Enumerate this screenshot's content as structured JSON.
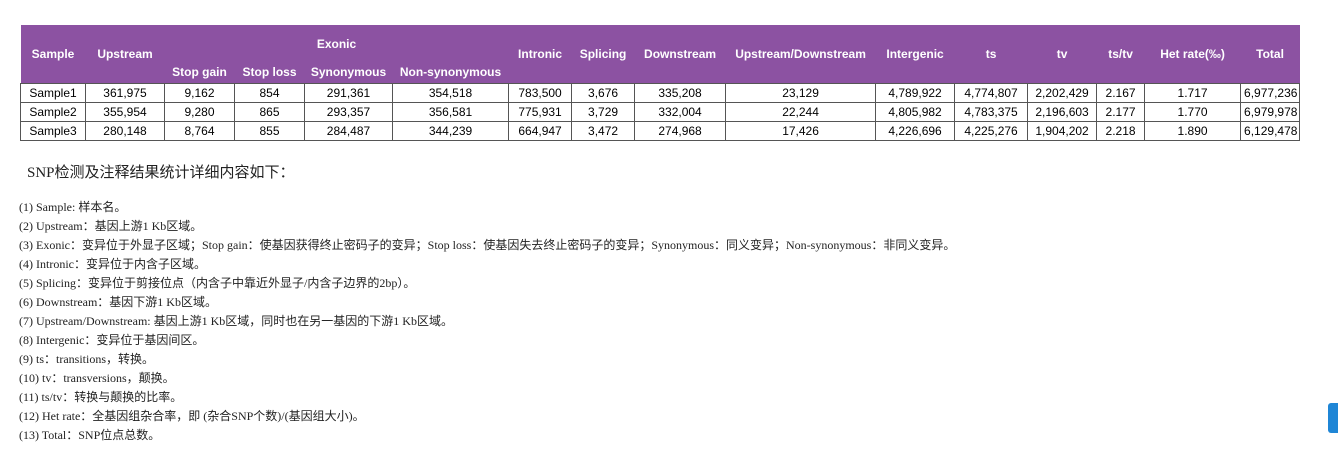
{
  "table": {
    "headers": {
      "sample": "Sample",
      "upstream": "Upstream",
      "exonic": "Exonic",
      "stop_gain": "Stop gain",
      "stop_loss": "Stop loss",
      "synonymous": "Synonymous",
      "non_synonymous": "Non-synonymous",
      "intronic": "Intronic",
      "splicing": "Splicing",
      "downstream": "Downstream",
      "upstream_downstream": "Upstream/Downstream",
      "intergenic": "Intergenic",
      "ts": "ts",
      "tv": "tv",
      "ts_tv": "ts/tv",
      "het_rate": "Het rate(‰)",
      "total": "Total"
    },
    "rows": [
      [
        "Sample1",
        "361,975",
        "9,162",
        "854",
        "291,361",
        "354,518",
        "783,500",
        "3,676",
        "335,208",
        "23,129",
        "4,789,922",
        "4,774,807",
        "2,202,429",
        "2.167",
        "1.717",
        "6,977,236"
      ],
      [
        "Sample2",
        "355,954",
        "9,280",
        "865",
        "293,357",
        "356,581",
        "775,931",
        "3,729",
        "332,004",
        "22,244",
        "4,805,982",
        "4,783,375",
        "2,196,603",
        "2.177",
        "1.770",
        "6,979,978"
      ],
      [
        "Sample3",
        "280,148",
        "8,764",
        "855",
        "284,487",
        "344,239",
        "664,947",
        "3,472",
        "274,968",
        "17,426",
        "4,226,696",
        "4,225,276",
        "1,904,202",
        "2.218",
        "1.890",
        "6,129,478"
      ]
    ]
  },
  "notes": {
    "title": "SNP检测及注释结果统计详细内容如下：",
    "items": [
      "(1) Sample: 样本名。",
      "(2) Upstream：基因上游1 Kb区域。",
      "(3) Exonic：变异位于外显子区域；Stop gain：使基因获得终止密码子的变异；Stop loss：使基因失去终止密码子的变异；Synonymous：同义变异；Non-synonymous：非同义变异。",
      "(4) Intronic：变异位于内含子区域。",
      "(5) Splicing：变异位于剪接位点（内含子中靠近外显子/内含子边界的2bp）。",
      "(6) Downstream：基因下游1 Kb区域。",
      "(7) Upstream/Downstream: 基因上游1 Kb区域，同时也在另一基因的下游1 Kb区域。",
      "(8) Intergenic：变异位于基因间区。",
      "(9) ts：transitions，转换。",
      "(10) tv：transversions，颠换。",
      "(11) ts/tv：转换与颠换的比率。",
      "(12) Het rate：全基因组杂合率，即 (杂合SNP个数)/(基因组大小)。",
      "(13) Total：SNP位点总数。"
    ]
  },
  "colors": {
    "header_bg": "#8c52a2",
    "header_text": "#ffffff",
    "side_tab": "#1f86d6"
  },
  "icons": {
    "side_tab": "side-tab"
  }
}
